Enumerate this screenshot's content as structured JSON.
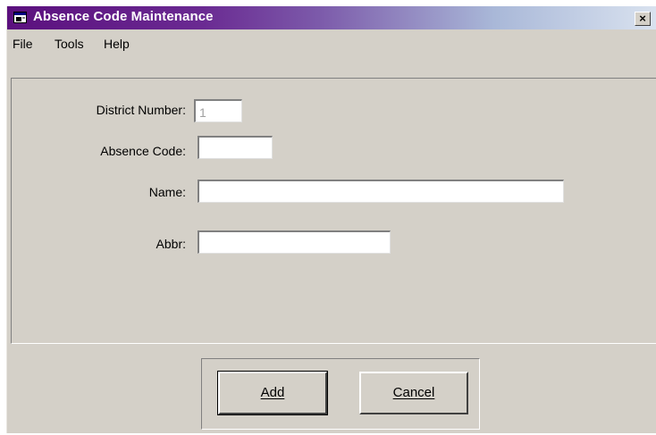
{
  "window": {
    "title": "Absence Code Maintenance",
    "close_glyph": "×"
  },
  "menu": {
    "items": [
      "File",
      "Tools",
      "Help"
    ]
  },
  "form": {
    "district_number": {
      "label": "District Number:",
      "value": "1"
    },
    "absence_code": {
      "label": "Absence Code:",
      "value": ""
    },
    "name": {
      "label": "Name:",
      "value": ""
    },
    "abbr": {
      "label": "Abbr:",
      "value": ""
    }
  },
  "buttons": {
    "add": "Add",
    "cancel": "Cancel"
  },
  "colors": {
    "titlebar_start": "#5b107e",
    "titlebar_end": "#d9e2ef",
    "face": "#d4d0c8"
  },
  "icons": {
    "app": "window-app-icon",
    "close": "close-icon"
  }
}
